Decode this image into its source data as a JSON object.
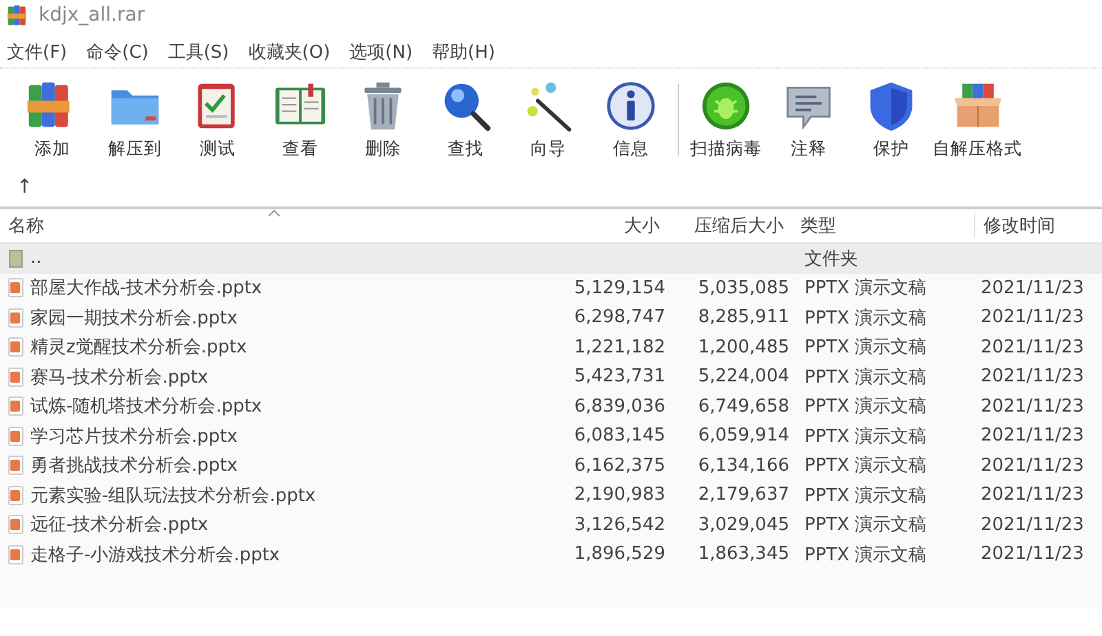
{
  "window": {
    "title": "kdjx_all.rar"
  },
  "menu": [
    {
      "label": "文件(F)"
    },
    {
      "label": "命令(C)"
    },
    {
      "label": "工具(S)"
    },
    {
      "label": "收藏夹(O)"
    },
    {
      "label": "选项(N)"
    },
    {
      "label": "帮助(H)"
    }
  ],
  "toolbar": {
    "groups": [
      {
        "buttons": [
          {
            "label": "添加"
          },
          {
            "label": "解压到"
          },
          {
            "label": "测试"
          },
          {
            "label": "查看"
          },
          {
            "label": "删除"
          },
          {
            "label": "查找"
          },
          {
            "label": "向导"
          },
          {
            "label": "信息"
          }
        ]
      },
      {
        "buttons": [
          {
            "label": "扫描病毒"
          },
          {
            "label": "注释"
          },
          {
            "label": "保护"
          },
          {
            "label": "自解压格式"
          }
        ]
      }
    ]
  },
  "path_bar": {
    "up_button": "↑"
  },
  "table": {
    "columns": [
      "名称",
      "大小",
      "压缩后大小",
      "类型",
      "修改时间"
    ],
    "rows": [
      {
        "kind": "parent",
        "selected": true,
        "name": "..",
        "size": "",
        "packed": "",
        "type": "文件夹",
        "modified": ""
      },
      {
        "kind": "file",
        "selected": false,
        "name": "部屋大作战-技术分析会.pptx",
        "size": "5,129,154",
        "packed": "5,035,085",
        "type": "PPTX 演示文稿",
        "modified": "2021/11/23"
      },
      {
        "kind": "file",
        "selected": false,
        "name": "家园一期技术分析会.pptx",
        "size": "6,298,747",
        "packed": "8,285,911",
        "type": "PPTX 演示文稿",
        "modified": "2021/11/23"
      },
      {
        "kind": "file",
        "selected": false,
        "name": "精灵z觉醒技术分析会.pptx",
        "size": "1,221,182",
        "packed": "1,200,485",
        "type": "PPTX 演示文稿",
        "modified": "2021/11/23"
      },
      {
        "kind": "file",
        "selected": false,
        "name": "赛马-技术分析会.pptx",
        "size": "5,423,731",
        "packed": "5,224,004",
        "type": "PPTX 演示文稿",
        "modified": "2021/11/23"
      },
      {
        "kind": "file",
        "selected": false,
        "name": "试炼-随机塔技术分析会.pptx",
        "size": "6,839,036",
        "packed": "6,749,658",
        "type": "PPTX 演示文稿",
        "modified": "2021/11/23"
      },
      {
        "kind": "file",
        "selected": false,
        "name": "学习芯片技术分析会.pptx",
        "size": "6,083,145",
        "packed": "6,059,914",
        "type": "PPTX 演示文稿",
        "modified": "2021/11/23"
      },
      {
        "kind": "file",
        "selected": false,
        "name": "勇者挑战技术分析会.pptx",
        "size": "6,162,375",
        "packed": "6,134,166",
        "type": "PPTX 演示文稿",
        "modified": "2021/11/23"
      },
      {
        "kind": "file",
        "selected": false,
        "name": "元素实验-组队玩法技术分析会.pptx",
        "size": "2,190,983",
        "packed": "2,179,637",
        "type": "PPTX 演示文稿",
        "modified": "2021/11/23"
      },
      {
        "kind": "file",
        "selected": false,
        "name": "远征-技术分析会.pptx",
        "size": "3,126,542",
        "packed": "3,029,045",
        "type": "PPTX 演示文稿",
        "modified": "2021/11/23"
      },
      {
        "kind": "file",
        "selected": false,
        "name": "走格子-小游戏技术分析会.pptx",
        "size": "1,896,529",
        "packed": "1,863,345",
        "type": "PPTX 演示文稿",
        "modified": "2021/11/23"
      }
    ]
  }
}
